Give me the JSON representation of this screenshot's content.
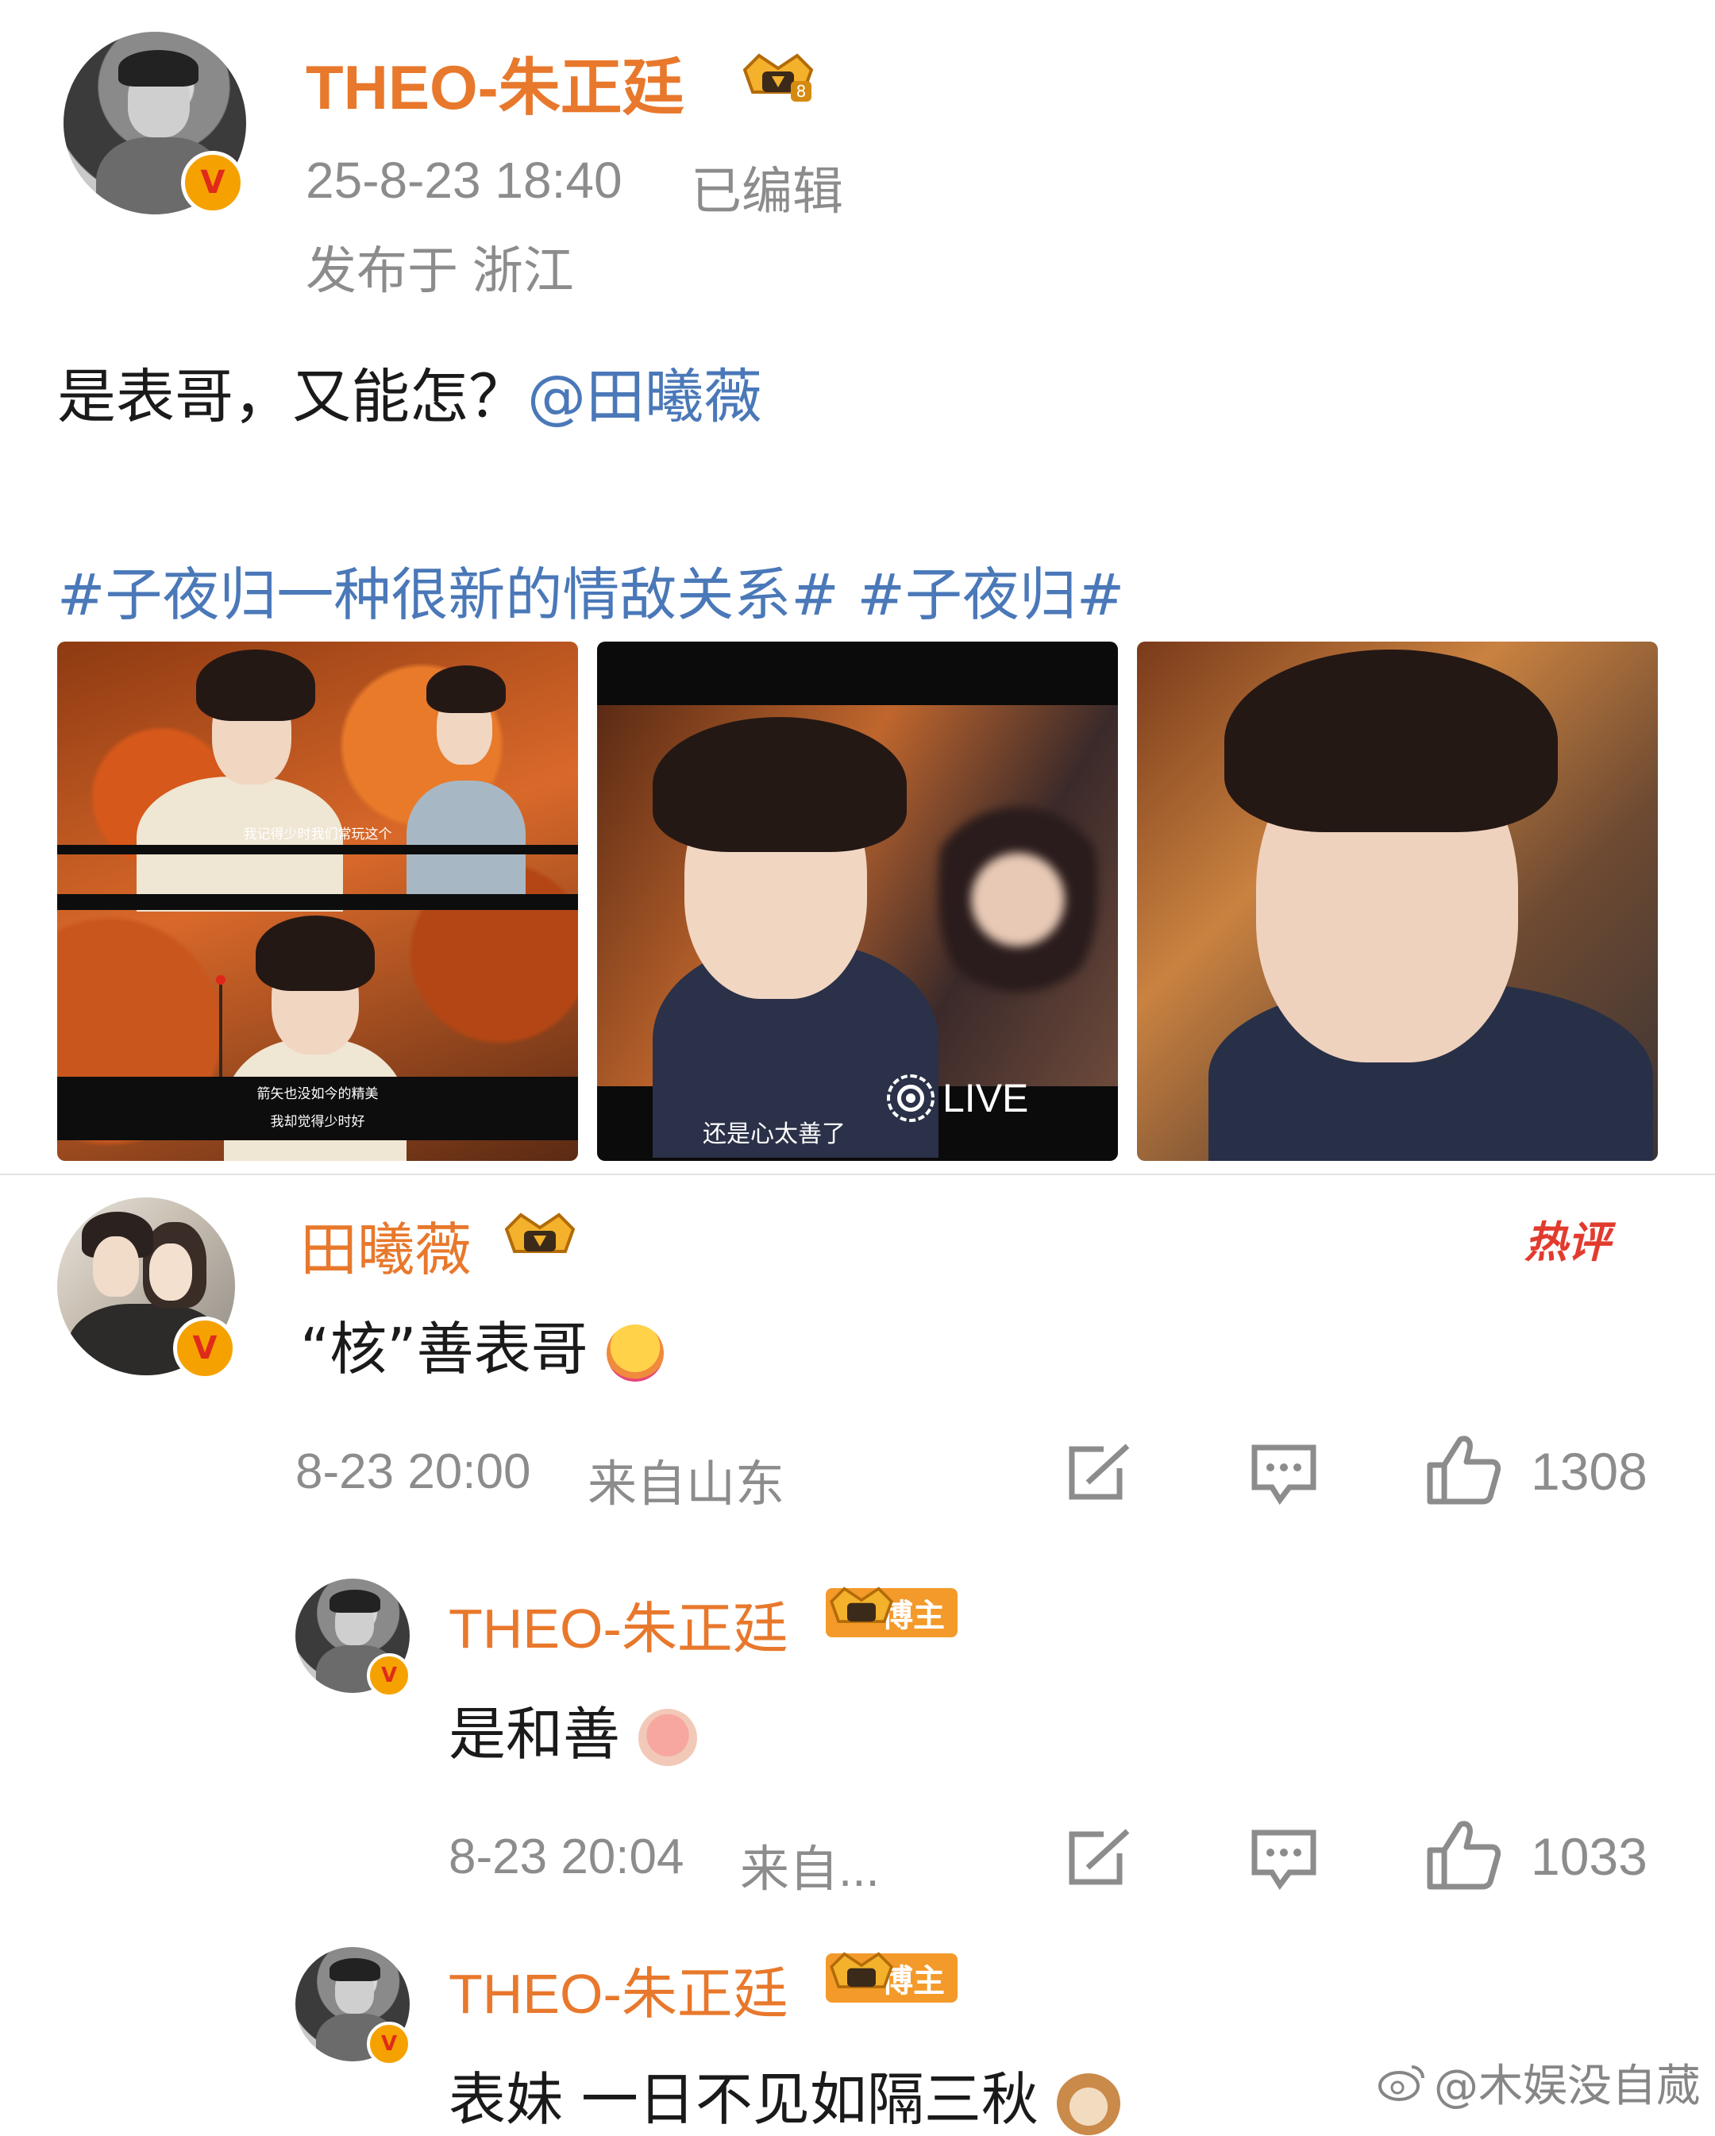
{
  "post": {
    "author": "THEO-朱正廷",
    "date": "25-8-23 18:40",
    "edited": "已编辑",
    "location": "发布于 浙江",
    "text": "是表哥，又能怎？",
    "mention": "@田曦薇",
    "hashtags": "#子夜归一种很新的情敌关系# #子夜归#",
    "images": [
      {
        "subtitle_top": "我记得少时我们常玩这个",
        "subtitle_bottom_1": "箭矢也没如今的精美",
        "subtitle_bottom_2": "我却觉得少时好"
      },
      {
        "subtitle": "还是心太善了",
        "live": "LIVE"
      },
      {}
    ]
  },
  "comments": [
    {
      "author": "田曦薇",
      "hot": "热评",
      "text": "“核”善表哥",
      "emoji": "hug-emoji",
      "time": "8-23 20:00",
      "location": "来自山东",
      "likes": "1308"
    },
    {
      "author": "THEO-朱正廷",
      "tag": "博主",
      "text": "是和善",
      "emoji": "shy-emoji",
      "time": "8-23 20:04",
      "location": "来自...",
      "likes": "1033"
    },
    {
      "author": "THEO-朱正廷",
      "tag": "博主",
      "text": "表妹 一日不见如隔三秋",
      "emoji": "cat-emoji"
    }
  ],
  "watermark": "@木娱没自蒇",
  "colors": {
    "username": "#e8782c",
    "link": "#4a78b8",
    "meta": "#8c8c8c",
    "badge": "#f5a200"
  }
}
